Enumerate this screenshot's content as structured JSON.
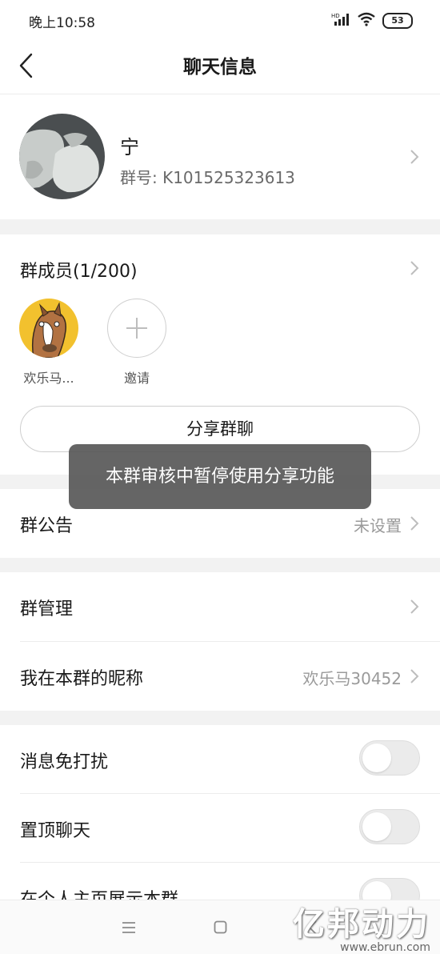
{
  "status_bar": {
    "time": "晚上10:58",
    "network": "HD",
    "battery": "53"
  },
  "nav": {
    "title": "聊天信息"
  },
  "group": {
    "name": "宁",
    "id_text": "群号: K101525323613"
  },
  "members": {
    "title": "群成员(1/200)",
    "items": [
      {
        "name": "欢乐马..."
      }
    ],
    "invite_label": "邀请"
  },
  "share_button": "分享群聊",
  "toast": "本群审核中暂停使用分享功能",
  "announcement": {
    "label": "群公告",
    "value": "未设置"
  },
  "manage": {
    "label": "群管理"
  },
  "nickname": {
    "label": "我在本群的昵称",
    "value": "欢乐马30452"
  },
  "mute": {
    "label": "消息免打扰",
    "on": false
  },
  "pin": {
    "label": "置顶聊天",
    "on": false
  },
  "show_on_profile": {
    "label": "在个人主页展示本群",
    "on": false
  },
  "watermark": {
    "logo": "亿邦动力",
    "url": "www.ebrun.com"
  },
  "colors": {
    "background": "#ffffff",
    "section_gap": "#f2f2f2",
    "toast_bg": "#585858",
    "secondary_text": "#9a9a9a"
  },
  "icons": [
    "back-chevron-icon",
    "chevron-right-icon",
    "plus-icon",
    "wifi-icon",
    "signal-icon",
    "menu-icon",
    "home-square-icon"
  ]
}
